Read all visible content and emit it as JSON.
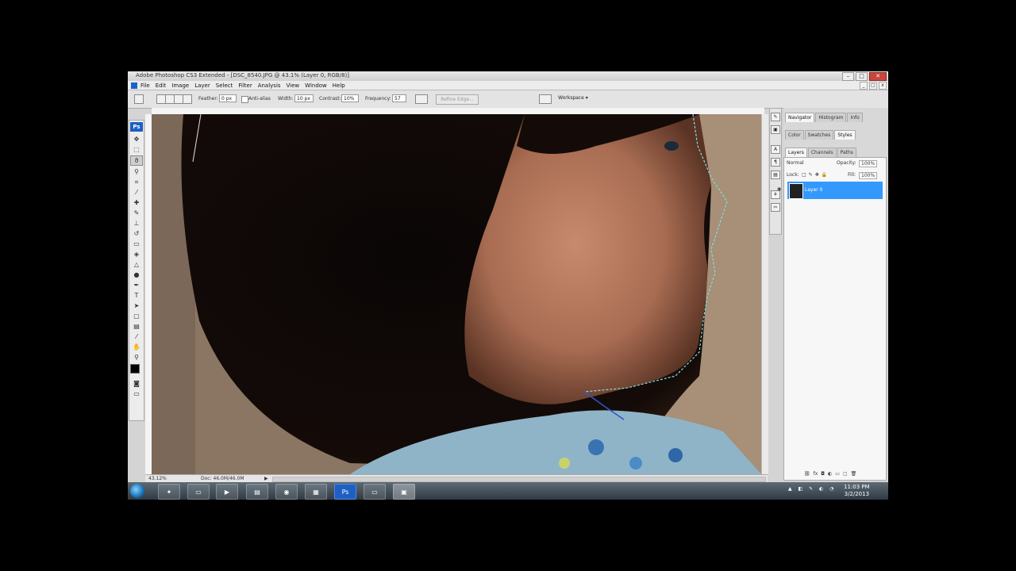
{
  "window": {
    "title": "Adobe Photoshop CS3 Extended - [DSC_8540.JPG @ 43.1% (Layer 0, RGB/8)]",
    "controls": {
      "minimize": "–",
      "maximize": "□",
      "close": "✕"
    }
  },
  "menu": [
    "File",
    "Edit",
    "Image",
    "Layer",
    "Select",
    "Filter",
    "Analysis",
    "View",
    "Window",
    "Help"
  ],
  "options": {
    "feather_label": "Feather:",
    "feather_value": "0 px",
    "antialias_label": "Anti-alias",
    "width_label": "Width:",
    "width_value": "10 px",
    "contrast_label": "Contrast:",
    "contrast_value": "10%",
    "frequency_label": "Frequency:",
    "frequency_value": "57",
    "refine_edge": "Refine Edge...",
    "workspace": "Workspace ▾"
  },
  "toolbox": {
    "logo": "Ps"
  },
  "status": {
    "zoom": "43.12%",
    "doc": "Doc: 46.0M/46.0M"
  },
  "panels": {
    "group1_tabs": [
      "Navigator",
      "Histogram",
      "Info"
    ],
    "group2_tabs": [
      "Color",
      "Swatches",
      "Styles"
    ],
    "group3_tabs": [
      "Layers",
      "Channels",
      "Paths"
    ],
    "blend_mode": "Normal",
    "opacity_label": "Opacity:",
    "opacity_value": "100%",
    "lock_label": "Lock:",
    "fill_label": "Fill:",
    "fill_value": "100%",
    "layer_name": "Layer 0"
  },
  "taskbar": {
    "time": "11:03 PM",
    "date": "3/2/2013"
  },
  "colors": {
    "accent": "#3399ff",
    "ps_blue": "#1e5fc4",
    "selection": "#7fe0e0"
  }
}
